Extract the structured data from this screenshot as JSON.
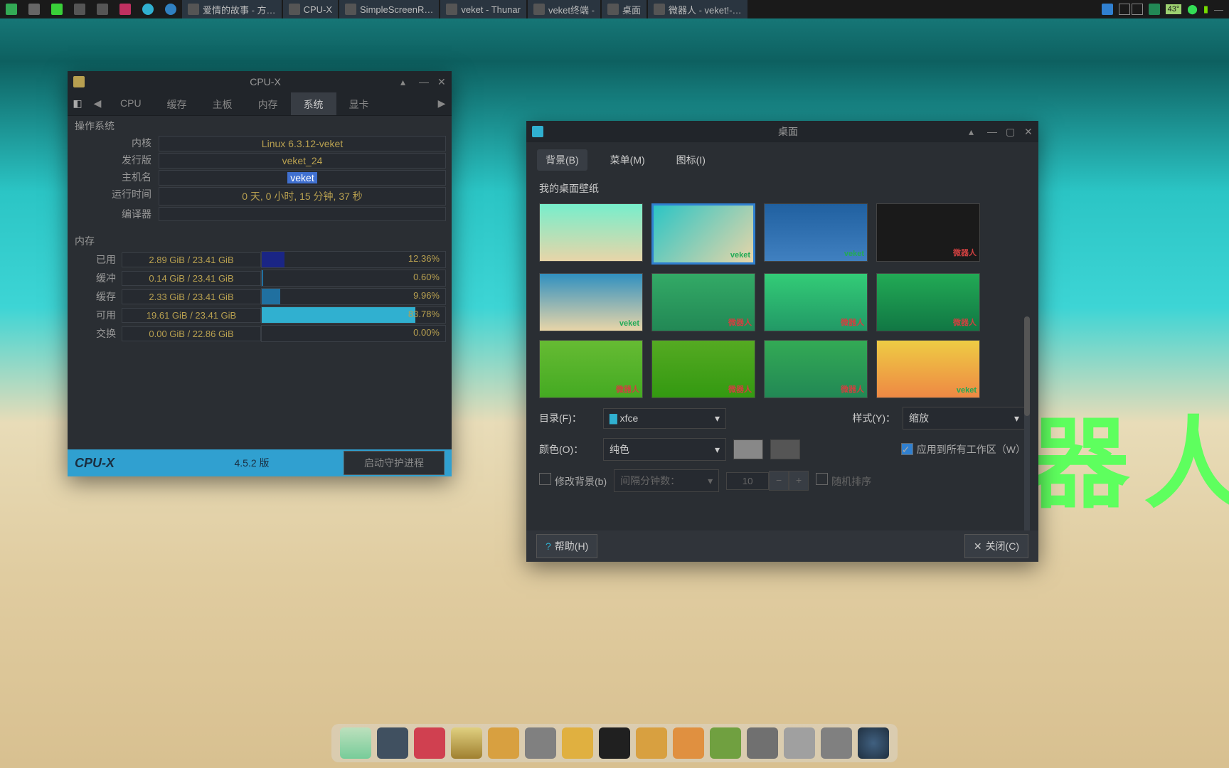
{
  "panel": {
    "tasks": [
      {
        "label": "爱情的故事 - 方…"
      },
      {
        "label": "CPU-X"
      },
      {
        "label": "SimpleScreenR…"
      },
      {
        "label": "veket - Thunar"
      },
      {
        "label": "veket终端 -"
      },
      {
        "label": "桌面"
      },
      {
        "label": "微器人 - veket!-…"
      }
    ],
    "tray": {
      "temp": "43°"
    }
  },
  "desktop_watermark": "器人",
  "cpux": {
    "title": "CPU-X",
    "tabs": [
      "CPU",
      "缓存",
      "主板",
      "内存",
      "系统",
      "显卡"
    ],
    "active_tab": 4,
    "os_section": "操作系统",
    "mem_section": "内存",
    "os": {
      "kernel_label": "内核",
      "kernel": "Linux 6.3.12-veket",
      "distro_label": "发行版",
      "distro": "veket_24",
      "hostname_label": "主机名",
      "hostname": "veket",
      "uptime_label": "运行时间",
      "uptime": "0 天, 0 小时, 15 分钟, 37 秒",
      "compiler_label": "编译器",
      "compiler": ""
    },
    "mem": [
      {
        "label": "已用",
        "text": "2.89 GiB / 23.41 GiB",
        "pct": "12.36%",
        "fill": 12.36,
        "cls": "navy"
      },
      {
        "label": "缓冲",
        "text": "0.14 GiB / 23.41 GiB",
        "pct": "0.60%",
        "fill": 0.6,
        "cls": ""
      },
      {
        "label": "缓存",
        "text": "2.33 GiB / 23.41 GiB",
        "pct": "9.96%",
        "fill": 9.96,
        "cls": ""
      },
      {
        "label": "可用",
        "text": "19.61 GiB / 23.41 GiB",
        "pct": "83.78%",
        "fill": 83.78,
        "cls": "cyan"
      },
      {
        "label": "交换",
        "text": "0.00 GiB / 22.86 GiB",
        "pct": "0.00%",
        "fill": 0,
        "cls": ""
      }
    ],
    "footer": {
      "logo": "CPU-X",
      "version": "4.5.2 版",
      "button": "启动守护进程"
    }
  },
  "dwin": {
    "title": "桌面",
    "tabs": [
      "背景(B)",
      "菜单(M)",
      "图标(I)"
    ],
    "active_tab": 0,
    "wallpapers_label": "我的桌面壁纸",
    "thumb_badges": [
      "",
      "veket",
      "veket",
      "微器人",
      "veket",
      "微器人",
      "微器人",
      "微器人",
      "微器人",
      "微器人",
      "微器人",
      "veket"
    ],
    "sel_thumb": 1,
    "dir_label": "目录(F)：",
    "dir_value": "xfce",
    "style_label": "样式(Y)：",
    "style_value": "缩放",
    "color_label": "颜色(O)：",
    "color_value": "纯色",
    "apply_all": "应用到所有工作区（W）",
    "change_bg": "修改背景(b)",
    "interval_label": "间隔分钟数：",
    "interval_value": "10",
    "random": "随机排序",
    "help": "帮助(H)",
    "close": "关闭(C)"
  }
}
